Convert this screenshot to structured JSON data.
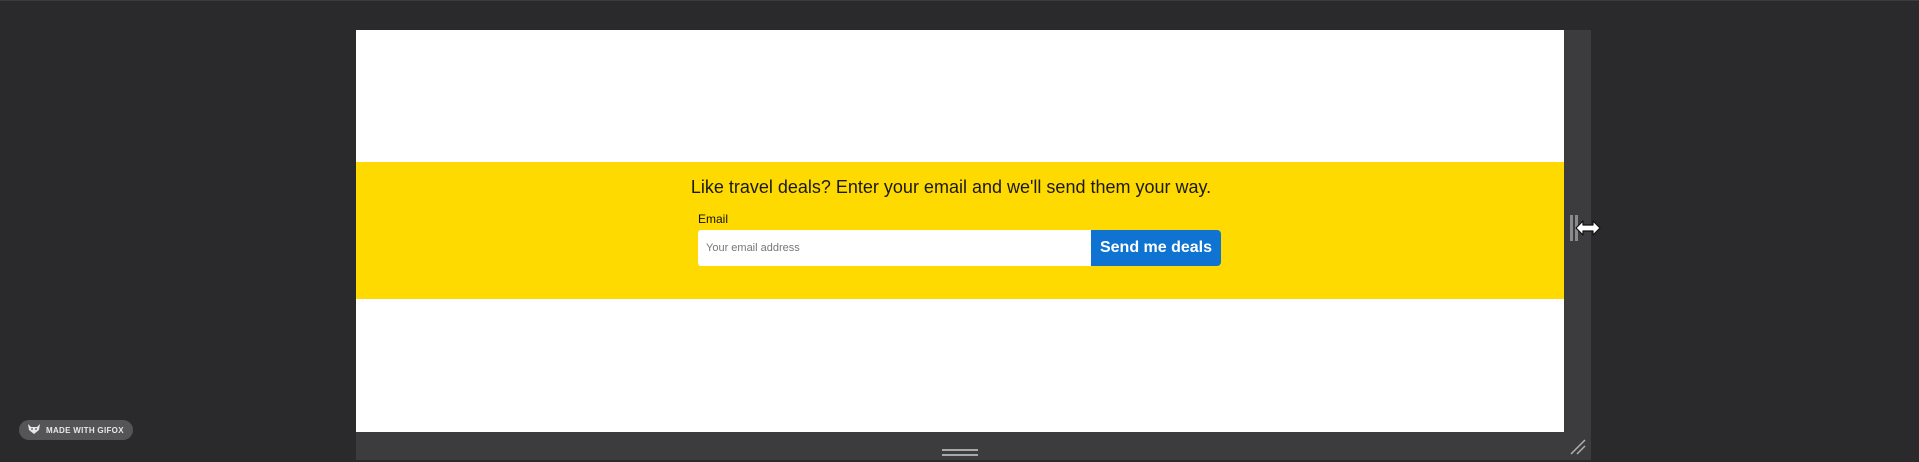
{
  "page": {
    "headline": "Like travel deals? Enter your email and we'll send them your way.",
    "form": {
      "email_label": "Email",
      "email_placeholder": "Your email address",
      "email_value": "",
      "submit_label": "Send me deals"
    }
  },
  "badge": {
    "label": "MADE WITH GIFOX",
    "icon": "fox-icon"
  },
  "colors": {
    "banner": "#ffda00",
    "button": "#0e73d1",
    "background": "#2a2a2c",
    "gutter": "#3c3c3f"
  },
  "icons": [
    "horizontal-resize-cursor-icon",
    "drag-handle-icon",
    "corner-resize-icon",
    "fox-icon"
  ]
}
